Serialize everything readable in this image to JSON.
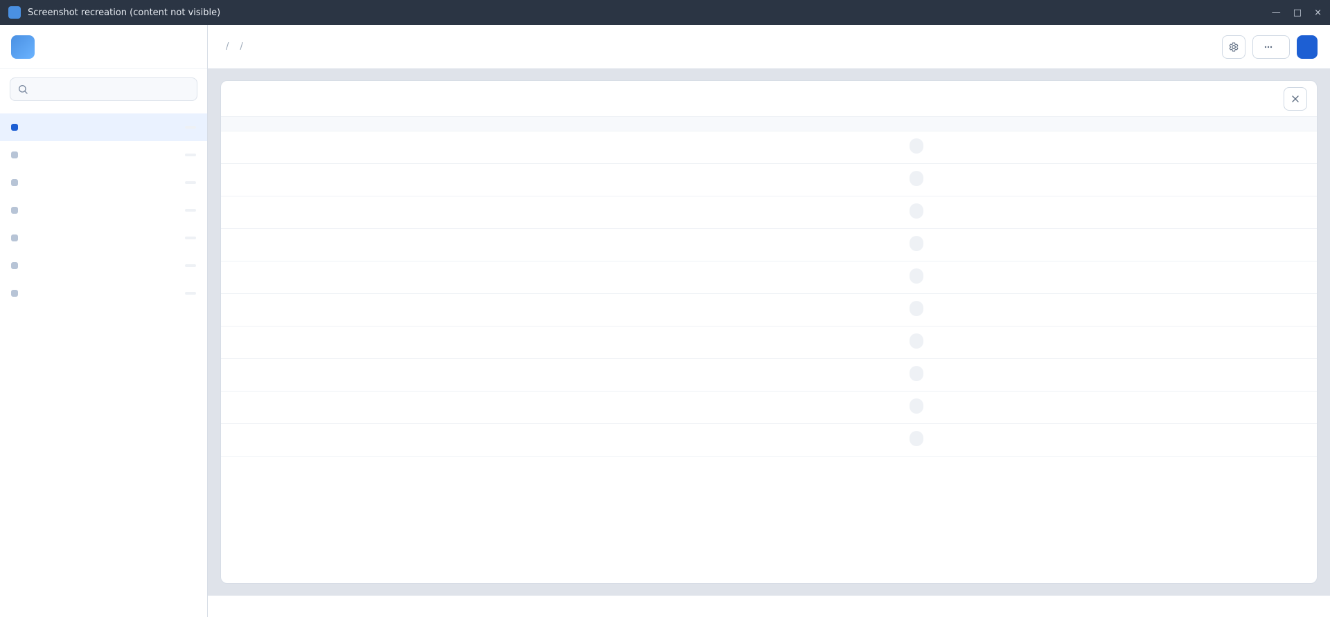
{
  "window": {
    "title": "Screenshot recreation (content not visible)",
    "controls": {
      "minimize": "—",
      "maximize": "□",
      "close": "×"
    }
  },
  "brand": {
    "name": ""
  },
  "sidebar": {
    "search_placeholder": "",
    "items": [
      {
        "label": "",
        "count": ""
      },
      {
        "label": "",
        "count": ""
      },
      {
        "label": "",
        "count": ""
      },
      {
        "label": "",
        "count": ""
      },
      {
        "label": "",
        "count": ""
      },
      {
        "label": "",
        "count": ""
      },
      {
        "label": "",
        "count": ""
      }
    ]
  },
  "topbar": {
    "breadcrumb": [
      "",
      "",
      ""
    ],
    "actions": {
      "secondary_label": "",
      "primary_label": ""
    }
  },
  "panel": {
    "title": "",
    "subtitle": "",
    "table": {
      "headers": [
        "",
        "",
        "",
        ""
      ],
      "rows": [
        [
          "",
          "",
          "",
          ""
        ],
        [
          "",
          "",
          "",
          ""
        ],
        [
          "",
          "",
          "",
          ""
        ],
        [
          "",
          "",
          "",
          ""
        ],
        [
          "",
          "",
          "",
          ""
        ],
        [
          "",
          "",
          "",
          ""
        ],
        [
          "",
          "",
          "",
          ""
        ],
        [
          "",
          "",
          "",
          ""
        ],
        [
          "",
          "",
          "",
          ""
        ],
        [
          "",
          "",
          "",
          ""
        ]
      ]
    }
  },
  "footer": {
    "left": "",
    "right": ""
  },
  "icons": {
    "search": "search-icon",
    "settings": "gear-icon",
    "more": "more-icon",
    "close": "close-icon"
  }
}
